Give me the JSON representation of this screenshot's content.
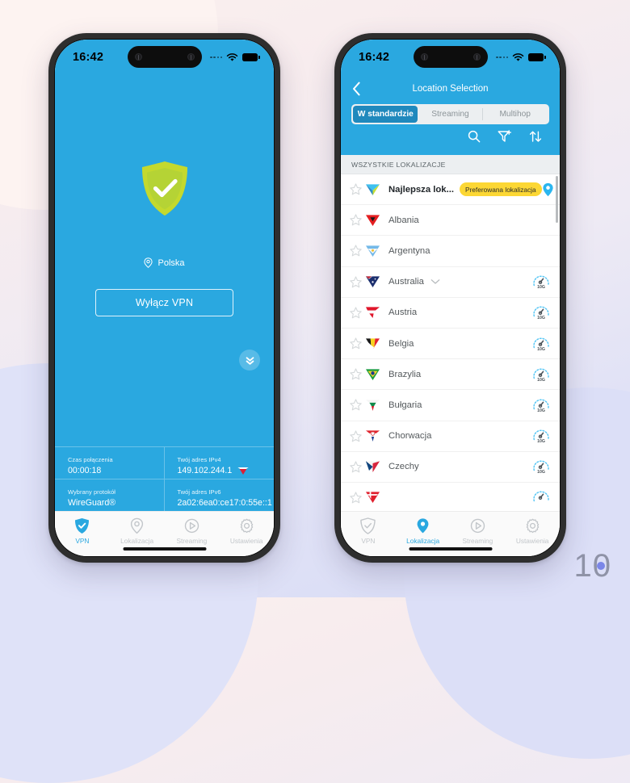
{
  "theme": {
    "brand_blue": "#2aa8e0",
    "seg_active": "#2089bd",
    "badge_yellow": "#fcd734",
    "shield_green": "#b5d335",
    "inactive_gray": "#c2c6ca"
  },
  "watermark": {
    "text": "10"
  },
  "phone_left": {
    "statusbar": {
      "time": "16:42"
    },
    "connected_location": "Polska",
    "disconnect_button": "Wyłącz VPN",
    "collapse_button_icon": "chevron-double-down-icon",
    "info": [
      {
        "label": "Czas połączenia",
        "value": "00:00:18",
        "flag": null
      },
      {
        "label": "Twój adres IPv4",
        "value": "149.102.244.1",
        "flag": "poland-flag-icon"
      },
      {
        "label": "Wybrany protokół",
        "value": "WireGuard®",
        "flag": null
      },
      {
        "label": "Twój adres IPv6",
        "value": "2a02:6ea0:ce17:0:55e::1",
        "flag": null
      }
    ],
    "tabs": [
      {
        "label": "VPN",
        "icon": "shield-check-icon",
        "active": true
      },
      {
        "label": "Lokalizacja",
        "icon": "location-pin-icon",
        "active": false
      },
      {
        "label": "Streaming",
        "icon": "play-circle-icon",
        "active": false
      },
      {
        "label": "Ustawienia",
        "icon": "gear-icon",
        "active": false
      }
    ]
  },
  "phone_right": {
    "statusbar": {
      "time": "16:42"
    },
    "header": {
      "title": "Location Selection",
      "back_icon": "chevron-left-icon"
    },
    "segments": [
      {
        "label": "W standardzie",
        "active": true
      },
      {
        "label": "Streaming",
        "active": false
      },
      {
        "label": "Multihop",
        "active": false
      }
    ],
    "toolbar_icons": [
      {
        "name": "search-icon"
      },
      {
        "name": "filter-add-icon"
      },
      {
        "name": "sort-icon"
      }
    ],
    "list_header": "WSZYSTKIE LOKALIZACJE",
    "locations": [
      {
        "name": "Najlepsza lok...",
        "badge": "Preferowana lokalizacja",
        "best": true,
        "pin": true,
        "speed": null,
        "expand": false,
        "flag": "best-location-flag-icon"
      },
      {
        "name": "Albania",
        "badge": null,
        "best": false,
        "pin": false,
        "speed": null,
        "expand": false,
        "flag": "albania-flag-icon"
      },
      {
        "name": "Argentyna",
        "badge": null,
        "best": false,
        "pin": false,
        "speed": null,
        "expand": false,
        "flag": "argentina-flag-icon"
      },
      {
        "name": "Australia",
        "badge": null,
        "best": false,
        "pin": false,
        "speed": "10G",
        "expand": true,
        "flag": "australia-flag-icon"
      },
      {
        "name": "Austria",
        "badge": null,
        "best": false,
        "pin": false,
        "speed": "10G",
        "expand": false,
        "flag": "austria-flag-icon"
      },
      {
        "name": "Belgia",
        "badge": null,
        "best": false,
        "pin": false,
        "speed": "10G",
        "expand": false,
        "flag": "belgium-flag-icon"
      },
      {
        "name": "Brazylia",
        "badge": null,
        "best": false,
        "pin": false,
        "speed": "10G",
        "expand": false,
        "flag": "brazil-flag-icon"
      },
      {
        "name": "Bułgaria",
        "badge": null,
        "best": false,
        "pin": false,
        "speed": "10G",
        "expand": false,
        "flag": "bulgaria-flag-icon"
      },
      {
        "name": "Chorwacja",
        "badge": null,
        "best": false,
        "pin": false,
        "speed": "10G",
        "expand": false,
        "flag": "croatia-flag-icon"
      },
      {
        "name": "Czechy",
        "badge": null,
        "best": false,
        "pin": false,
        "speed": "10G",
        "expand": false,
        "flag": "czechia-flag-icon"
      },
      {
        "name": "",
        "badge": null,
        "best": false,
        "pin": false,
        "speed": "10G",
        "expand": false,
        "flag": "denmark-flag-icon"
      }
    ],
    "tabs": [
      {
        "label": "VPN",
        "icon": "shield-check-icon",
        "active": false
      },
      {
        "label": "Lokalizacja",
        "icon": "location-pin-icon",
        "active": true
      },
      {
        "label": "Streaming",
        "icon": "play-circle-icon",
        "active": false
      },
      {
        "label": "Ustawienia",
        "icon": "gear-icon",
        "active": false
      }
    ]
  }
}
